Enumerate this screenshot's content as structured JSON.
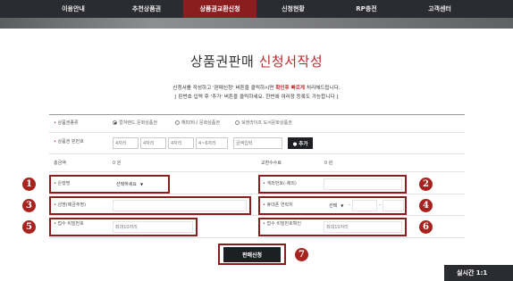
{
  "nav": {
    "tabs": [
      {
        "label": "이용안내"
      },
      {
        "label": "추천상품권"
      },
      {
        "label": "상품권교환신청",
        "active": true
      },
      {
        "label": "신청현황"
      },
      {
        "label": "RP충전"
      },
      {
        "label": "고객센터"
      }
    ]
  },
  "page": {
    "title_main": "상품권판매 ",
    "title_highlight": "신청서작성",
    "desc1_pre": "신청서를 작성하고 '판매신청' 버튼을 클릭하시면 ",
    "desc1_bold": "확인후 빠르게",
    "desc1_post": " 처리해드립니다.",
    "desc2": "[ 핀번호 입력 후 '추가' 버튼을 클릭하세요. 한번에 여러장 등록도 가능합니다 ]"
  },
  "form": {
    "type_label": "상품권종류",
    "type_options": [
      "컬쳐랜드 문화상품권",
      "해피머니 문화상품권",
      "북앤라이프 도서문화상품권"
    ],
    "pin_label": "상품권 핀번호",
    "pin_placeholders": [
      "4자리",
      "4자리",
      "4자리",
      "4~6자리"
    ],
    "amount_placeholder": "금액입력",
    "add_button": "● 추가",
    "total_label": "총금액",
    "total_value": "0 원",
    "fee_label": "교환수수료",
    "fee_value": "0 원",
    "bank_label": "은행명",
    "bank_select": "선택하세요",
    "account_label": "계좌번호(-제외)",
    "name_label": "성명(예금주명)",
    "phone_label": "휴대폰 연락처",
    "phone_select": "선택",
    "phone_sep1": "-",
    "phone_sep2": "-",
    "pw_label": "접수 비밀번호",
    "pw_placeholder": "최대10자리",
    "pw_confirm_label": "접수 비밀번호확인",
    "pw_confirm_placeholder": "최대10자리",
    "submit_label": "판매신청"
  },
  "badges": [
    "1",
    "2",
    "3",
    "4",
    "5",
    "6",
    "7"
  ],
  "footer": {
    "realtime_label": "실시간 1:1"
  },
  "colors": {
    "nav_bg": "#2b2c31",
    "nav_active": "#8a1e1e",
    "accent": "#c0252c",
    "highlight_border": "#8b1d1d",
    "badge": "#a8231f"
  }
}
